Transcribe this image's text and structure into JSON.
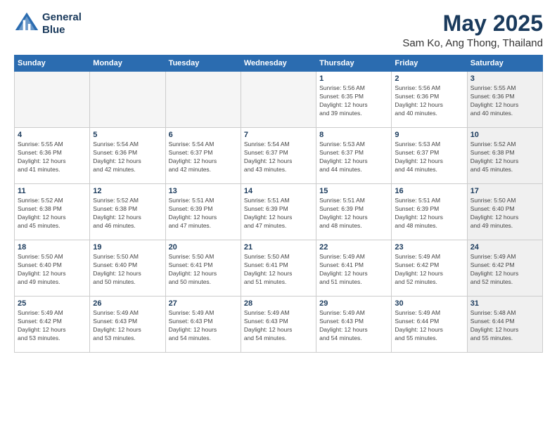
{
  "logo": {
    "line1": "General",
    "line2": "Blue"
  },
  "title": "May 2025",
  "subtitle": "Sam Ko, Ang Thong, Thailand",
  "days_header": [
    "Sunday",
    "Monday",
    "Tuesday",
    "Wednesday",
    "Thursday",
    "Friday",
    "Saturday"
  ],
  "weeks": [
    {
      "days": [
        {
          "num": "",
          "info": "",
          "empty": true
        },
        {
          "num": "",
          "info": "",
          "empty": true
        },
        {
          "num": "",
          "info": "",
          "empty": true
        },
        {
          "num": "",
          "info": "",
          "empty": true
        },
        {
          "num": "1",
          "info": "Sunrise: 5:56 AM\nSunset: 6:35 PM\nDaylight: 12 hours\nand 39 minutes.",
          "shaded": false
        },
        {
          "num": "2",
          "info": "Sunrise: 5:56 AM\nSunset: 6:36 PM\nDaylight: 12 hours\nand 40 minutes.",
          "shaded": false
        },
        {
          "num": "3",
          "info": "Sunrise: 5:55 AM\nSunset: 6:36 PM\nDaylight: 12 hours\nand 40 minutes.",
          "shaded": true
        }
      ]
    },
    {
      "days": [
        {
          "num": "4",
          "info": "Sunrise: 5:55 AM\nSunset: 6:36 PM\nDaylight: 12 hours\nand 41 minutes.",
          "shaded": false
        },
        {
          "num": "5",
          "info": "Sunrise: 5:54 AM\nSunset: 6:36 PM\nDaylight: 12 hours\nand 42 minutes.",
          "shaded": false
        },
        {
          "num": "6",
          "info": "Sunrise: 5:54 AM\nSunset: 6:37 PM\nDaylight: 12 hours\nand 42 minutes.",
          "shaded": false
        },
        {
          "num": "7",
          "info": "Sunrise: 5:54 AM\nSunset: 6:37 PM\nDaylight: 12 hours\nand 43 minutes.",
          "shaded": false
        },
        {
          "num": "8",
          "info": "Sunrise: 5:53 AM\nSunset: 6:37 PM\nDaylight: 12 hours\nand 44 minutes.",
          "shaded": false
        },
        {
          "num": "9",
          "info": "Sunrise: 5:53 AM\nSunset: 6:37 PM\nDaylight: 12 hours\nand 44 minutes.",
          "shaded": false
        },
        {
          "num": "10",
          "info": "Sunrise: 5:52 AM\nSunset: 6:38 PM\nDaylight: 12 hours\nand 45 minutes.",
          "shaded": true
        }
      ]
    },
    {
      "days": [
        {
          "num": "11",
          "info": "Sunrise: 5:52 AM\nSunset: 6:38 PM\nDaylight: 12 hours\nand 45 minutes.",
          "shaded": false
        },
        {
          "num": "12",
          "info": "Sunrise: 5:52 AM\nSunset: 6:38 PM\nDaylight: 12 hours\nand 46 minutes.",
          "shaded": false
        },
        {
          "num": "13",
          "info": "Sunrise: 5:51 AM\nSunset: 6:39 PM\nDaylight: 12 hours\nand 47 minutes.",
          "shaded": false
        },
        {
          "num": "14",
          "info": "Sunrise: 5:51 AM\nSunset: 6:39 PM\nDaylight: 12 hours\nand 47 minutes.",
          "shaded": false
        },
        {
          "num": "15",
          "info": "Sunrise: 5:51 AM\nSunset: 6:39 PM\nDaylight: 12 hours\nand 48 minutes.",
          "shaded": false
        },
        {
          "num": "16",
          "info": "Sunrise: 5:51 AM\nSunset: 6:39 PM\nDaylight: 12 hours\nand 48 minutes.",
          "shaded": false
        },
        {
          "num": "17",
          "info": "Sunrise: 5:50 AM\nSunset: 6:40 PM\nDaylight: 12 hours\nand 49 minutes.",
          "shaded": true
        }
      ]
    },
    {
      "days": [
        {
          "num": "18",
          "info": "Sunrise: 5:50 AM\nSunset: 6:40 PM\nDaylight: 12 hours\nand 49 minutes.",
          "shaded": false
        },
        {
          "num": "19",
          "info": "Sunrise: 5:50 AM\nSunset: 6:40 PM\nDaylight: 12 hours\nand 50 minutes.",
          "shaded": false
        },
        {
          "num": "20",
          "info": "Sunrise: 5:50 AM\nSunset: 6:41 PM\nDaylight: 12 hours\nand 50 minutes.",
          "shaded": false
        },
        {
          "num": "21",
          "info": "Sunrise: 5:50 AM\nSunset: 6:41 PM\nDaylight: 12 hours\nand 51 minutes.",
          "shaded": false
        },
        {
          "num": "22",
          "info": "Sunrise: 5:49 AM\nSunset: 6:41 PM\nDaylight: 12 hours\nand 51 minutes.",
          "shaded": false
        },
        {
          "num": "23",
          "info": "Sunrise: 5:49 AM\nSunset: 6:42 PM\nDaylight: 12 hours\nand 52 minutes.",
          "shaded": false
        },
        {
          "num": "24",
          "info": "Sunrise: 5:49 AM\nSunset: 6:42 PM\nDaylight: 12 hours\nand 52 minutes.",
          "shaded": true
        }
      ]
    },
    {
      "days": [
        {
          "num": "25",
          "info": "Sunrise: 5:49 AM\nSunset: 6:42 PM\nDaylight: 12 hours\nand 53 minutes.",
          "shaded": false
        },
        {
          "num": "26",
          "info": "Sunrise: 5:49 AM\nSunset: 6:43 PM\nDaylight: 12 hours\nand 53 minutes.",
          "shaded": false
        },
        {
          "num": "27",
          "info": "Sunrise: 5:49 AM\nSunset: 6:43 PM\nDaylight: 12 hours\nand 54 minutes.",
          "shaded": false
        },
        {
          "num": "28",
          "info": "Sunrise: 5:49 AM\nSunset: 6:43 PM\nDaylight: 12 hours\nand 54 minutes.",
          "shaded": false
        },
        {
          "num": "29",
          "info": "Sunrise: 5:49 AM\nSunset: 6:43 PM\nDaylight: 12 hours\nand 54 minutes.",
          "shaded": false
        },
        {
          "num": "30",
          "info": "Sunrise: 5:49 AM\nSunset: 6:44 PM\nDaylight: 12 hours\nand 55 minutes.",
          "shaded": false
        },
        {
          "num": "31",
          "info": "Sunrise: 5:48 AM\nSunset: 6:44 PM\nDaylight: 12 hours\nand 55 minutes.",
          "shaded": true
        }
      ]
    }
  ]
}
